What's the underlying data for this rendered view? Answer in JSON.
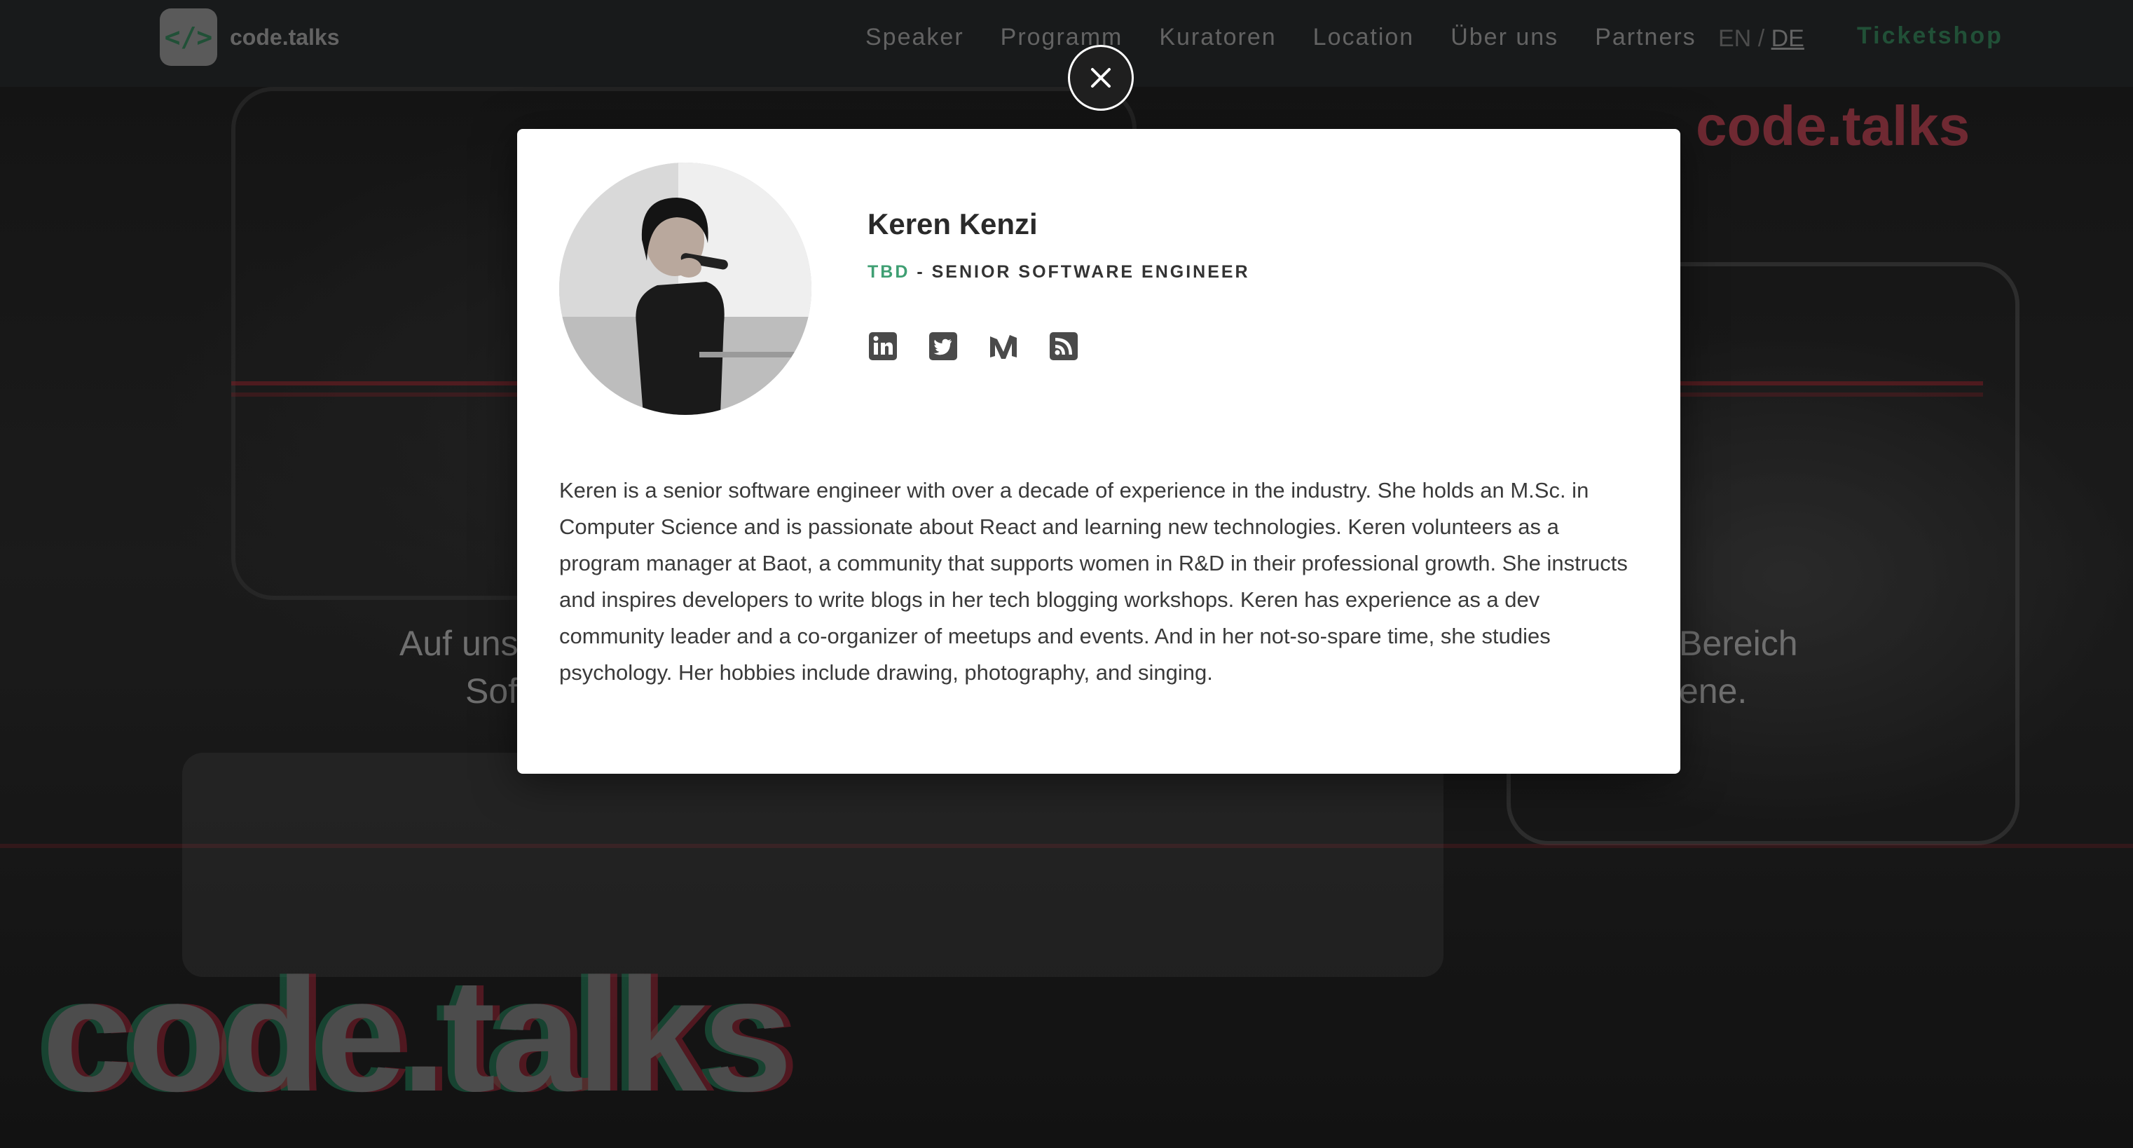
{
  "nav": {
    "logo_text": "code.talks",
    "logo_icon": "code-brackets-icon",
    "links": [
      "Speaker",
      "Programm",
      "Kuratoren",
      "Location",
      "Über uns",
      "Partners"
    ],
    "lang_en": "EN",
    "lang_sep": "/",
    "lang_de": "DE",
    "ticketshop": "Ticketshop"
  },
  "hero": {
    "brand_big": "code.talks",
    "brand_top": "code.talks",
    "tagline_left_1": "Auf uns",
    "tagline_right_1": "Bereich",
    "tagline_left_2": "Sof",
    "tagline_right_2": "ene."
  },
  "modal": {
    "close_icon": "close-icon",
    "name": "Keren Kenzi",
    "talk": "TBD",
    "role_sep": " - ",
    "role": "SENIOR SOFTWARE ENGINEER",
    "socials": [
      "linkedin-icon",
      "twitter-icon",
      "medium-icon",
      "rss-icon"
    ],
    "bio": "Keren is a senior software engineer with over a decade of experience in the industry. She holds an M.Sc. in Computer Science and is passionate about React and learning new technologies. Keren volunteers as a program manager at Baot, a community that supports women in R&D in their professional growth. She instructs and inspires developers to write blogs in her tech blogging workshops. Keren has experience as a dev community leader and a co-organizer of meetups and events. And in her not-so-spare time, she studies psychology. Her hobbies include drawing, photography, and singing."
  },
  "colors": {
    "accent": "#3f9f73",
    "nav_bg": "#222426",
    "text": "#2a2a2a"
  }
}
